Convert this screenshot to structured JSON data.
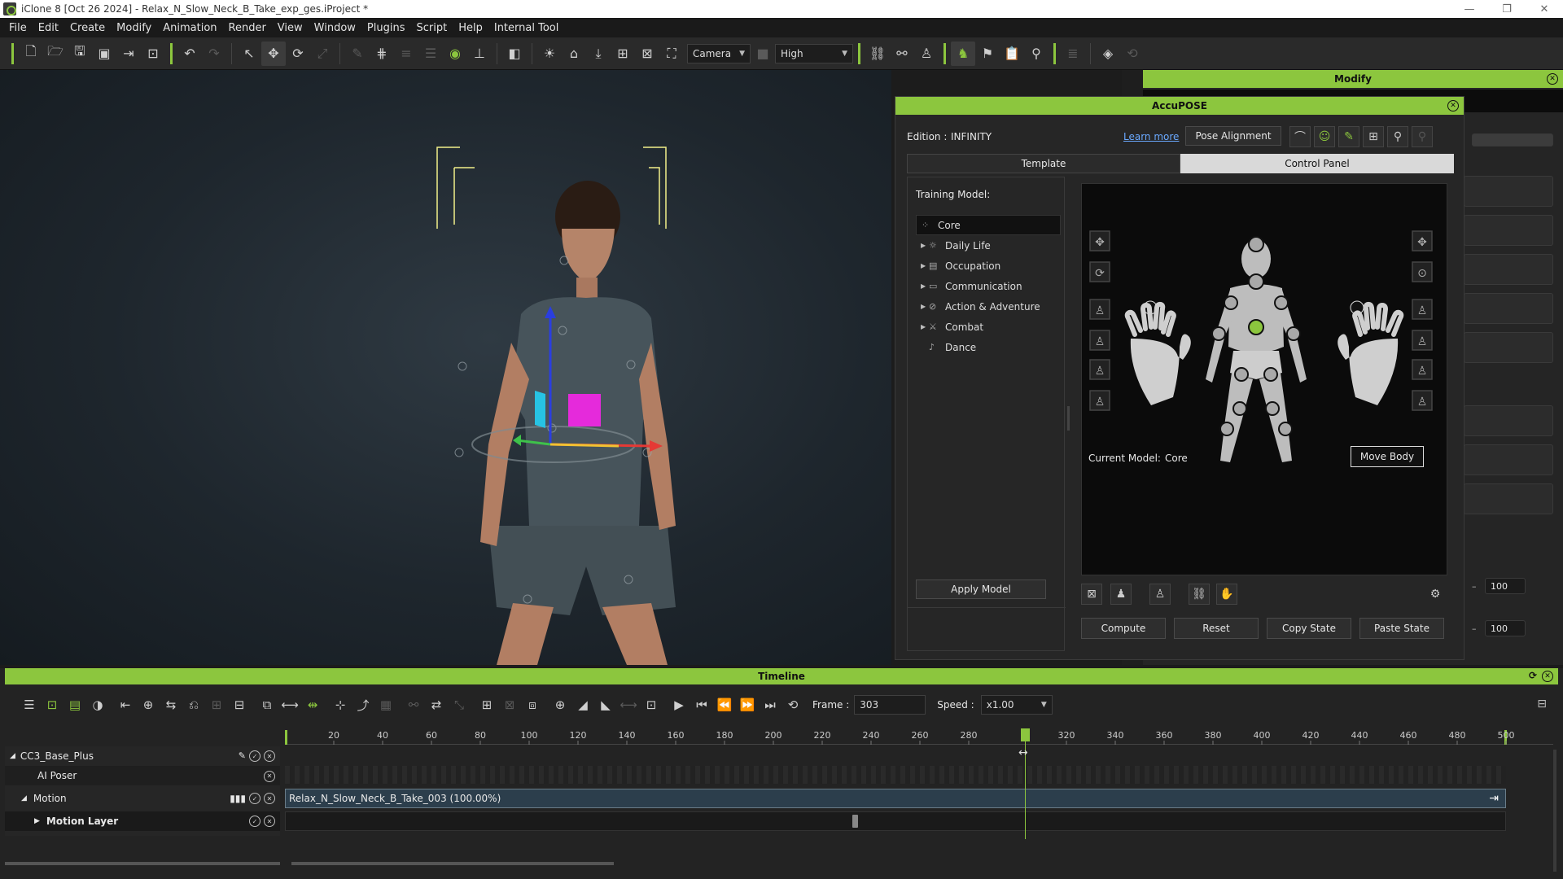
{
  "window": {
    "title": "iClone 8 [Oct 26 2024] - Relax_N_Slow_Neck_B_Take_exp_ges.iProject *",
    "minimize": "—",
    "maximize": "❐",
    "close": "✕"
  },
  "menu": [
    "File",
    "Edit",
    "Create",
    "Modify",
    "Animation",
    "Render",
    "View",
    "Window",
    "Plugins",
    "Script",
    "Help",
    "Internal Tool"
  ],
  "toolbar": {
    "camera_select": "Camera",
    "quality_select": "High"
  },
  "modify_panel": {
    "title": "Modify",
    "spin1": "100",
    "spin2": "100"
  },
  "accupose": {
    "title": "AccuPOSE",
    "edition_label": "Edition :",
    "edition_value": "INFINITY",
    "learn_more": "Learn more",
    "pose_alignment": "Pose Alignment",
    "tabs": [
      "Template",
      "Control Panel"
    ],
    "active_tab": "Control Panel",
    "training_model_label": "Training Model:",
    "tree": [
      {
        "label": "Core",
        "selected": true,
        "expandable": false
      },
      {
        "label": "Daily Life",
        "selected": false,
        "expandable": true
      },
      {
        "label": "Occupation",
        "selected": false,
        "expandable": true
      },
      {
        "label": "Communication",
        "selected": false,
        "expandable": true
      },
      {
        "label": "Action & Adventure",
        "selected": false,
        "expandable": true
      },
      {
        "label": "Combat",
        "selected": false,
        "expandable": true
      },
      {
        "label": "Dance",
        "selected": false,
        "expandable": false
      }
    ],
    "apply_model": "Apply Model",
    "current_model_label": "Current Model:",
    "current_model_value": "Core",
    "move_body": "Move Body",
    "compute": "Compute",
    "reset": "Reset",
    "copy_state": "Copy State",
    "paste_state": "Paste State"
  },
  "timeline": {
    "title": "Timeline",
    "frame_label": "Frame :",
    "frame_value": "303",
    "speed_label": "Speed :",
    "speed_value": "x1.00",
    "ruler_ticks": [
      "20",
      "40",
      "60",
      "80",
      "100",
      "120",
      "140",
      "160",
      "180",
      "200",
      "220",
      "240",
      "260",
      "280",
      "320",
      "340",
      "360",
      "380",
      "400",
      "420",
      "440",
      "460",
      "480",
      "500"
    ],
    "ruler_max": 500,
    "current_frame": 303,
    "tracks": {
      "object": "CC3_Base_Plus",
      "ai_poser": "AI Poser",
      "motion": "Motion",
      "motion_layer": "Motion Layer"
    },
    "clip_label": "Relax_N_Slow_Neck_B_Take_003 (100.00%)"
  },
  "colors": {
    "accent": "#8cc63e",
    "clip": "#2c3e4c",
    "gizmo_x": "#e53935",
    "gizmo_y": "#3ec24a",
    "gizmo_z": "#2a3ee0"
  }
}
